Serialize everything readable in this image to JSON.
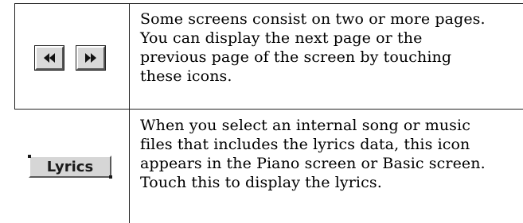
{
  "rows": [
    {
      "icons": [
        {
          "name": "page-back",
          "glyph": "double-left-arrow-icon"
        },
        {
          "name": "page-forward",
          "glyph": "double-right-arrow-icon"
        }
      ],
      "description": "Some screens consist on two or more pages.\nYou can display the next page or the\nprevious page of the screen by touching\nthese icons."
    },
    {
      "button_label": "Lyrics",
      "description": "When you select an internal song or music\nfiles that includes the lyrics data, this icon\nappears in the Piano screen or Basic screen.\nTouch this to display the lyrics."
    }
  ],
  "colors": {
    "rule": "#222222",
    "button_face": "#d9d9d9",
    "text": "#000000"
  }
}
